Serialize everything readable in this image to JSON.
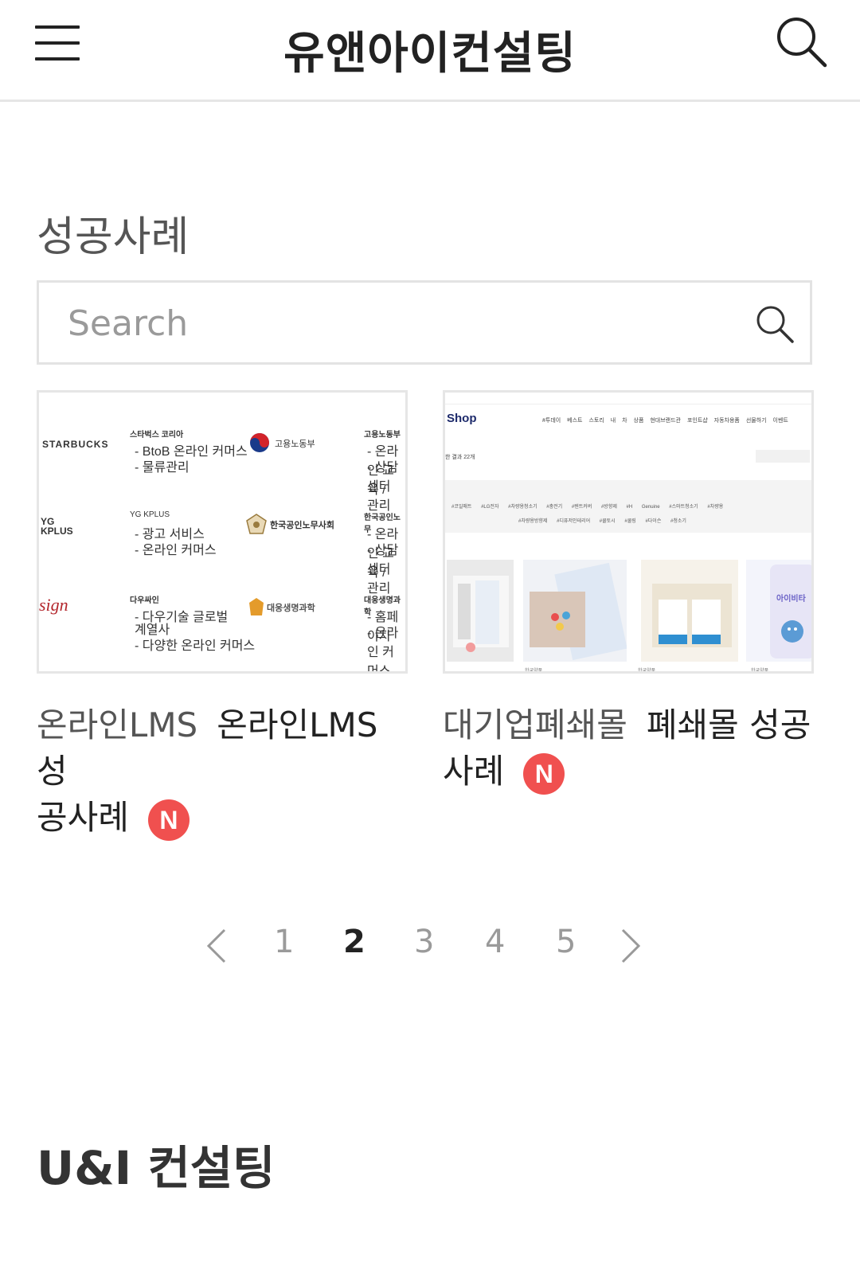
{
  "header": {
    "title": "유앤아이컨설팅",
    "menu_icon": "hamburger-menu-icon",
    "search_icon": "search-icon"
  },
  "section": {
    "title": "성공사례"
  },
  "search": {
    "placeholder": "Search",
    "icon": "search-icon"
  },
  "cards": [
    {
      "category": "온라인LMS",
      "title_main": "온라인LMS 성",
      "title_wrap": "공사례",
      "badge": "N",
      "thumbnail": {
        "logos": [
          {
            "brand": "STARBUCKS",
            "name": "스타벅스 코리아",
            "lines": [
              "- BtoB 온라인 커머스",
              "- 물류관리"
            ]
          },
          {
            "brand": "고용노동부",
            "name": "고용노동부",
            "lines": [
              "- 온라인 교육 /",
              "- 상담센터 관리"
            ]
          },
          {
            "brand": "YG KPLUS",
            "name": "YG KPLUS",
            "lines": [
              "- 광고 서비스",
              "- 온라인 커머스"
            ]
          },
          {
            "brand": "한국공인노무사회",
            "name": "한국공인노무",
            "lines": [
              "- 온라인 교육 /",
              "- 상담센터 관리"
            ]
          },
          {
            "brand": "sign",
            "name": "다우싸인",
            "lines": [
              "- 다우기술 글로벌",
              "계열사",
              "- 다양한 온라인 커머스"
            ]
          },
          {
            "brand": "대웅생명과학",
            "name": "대웅생명과학",
            "lines": [
              "- 홈페이지",
              "- 온라인 커머스"
            ]
          }
        ]
      }
    },
    {
      "category": "대기업폐쇄몰",
      "title_main": "폐쇄몰 성공",
      "title_wrap": "사례",
      "badge": "N",
      "thumbnail": {
        "logo": "Shop",
        "nav": [
          "#투데이",
          "베스트",
          "스토리",
          "내 차 상품",
          "현대브랜드관",
          "포인트샵",
          "자동차용품",
          "선물하기",
          "이벤트"
        ],
        "result_text": "한 결과 22개",
        "tags_row1": [
          "#코일매트",
          "#LG전자",
          "#차량용청소기",
          "#충전기",
          "#텐트커버",
          "#방향제",
          "#H Genuine",
          "#스마트청소기",
          "#차량용"
        ],
        "tags_row2": [
          "#차량용방향제",
          "#디퓨저인테리어",
          "#쿨토시",
          "#쿨링",
          "#다이슨",
          "#청소기"
        ],
        "product_brand": "한국약품",
        "product_label": "아이비타"
      }
    }
  ],
  "pagination": {
    "prev_icon": "chevron-left-icon",
    "next_icon": "chevron-right-icon",
    "pages": [
      "1",
      "2",
      "3",
      "4",
      "5"
    ],
    "current": "2"
  },
  "footer": {
    "brand": "U&I 컨설팅"
  }
}
